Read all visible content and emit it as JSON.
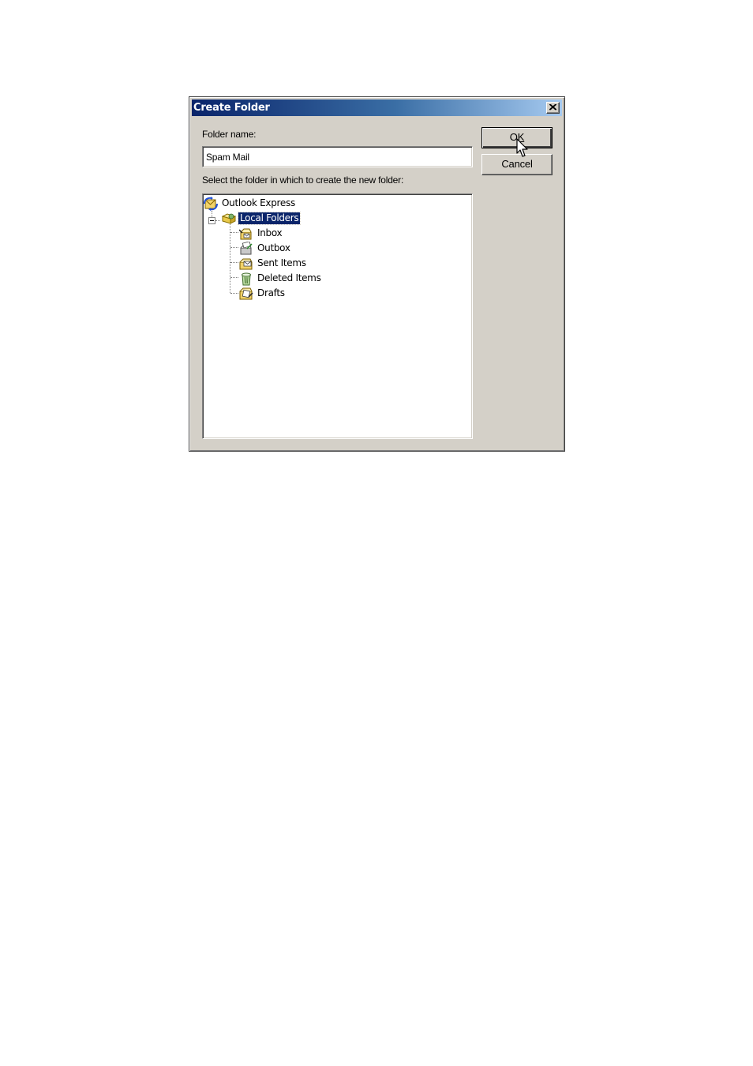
{
  "dialog": {
    "title": "Create Folder",
    "close_icon": "close-x-icon",
    "folder_name_label": "Folder name:",
    "folder_name_value": "Spam Mail",
    "select_label": "Select the folder in which to create the new folder:",
    "ok_prefix": "O",
    "ok_underlined": "K",
    "cancel_label": "Cancel"
  },
  "tree": {
    "root": {
      "label": "Outlook Express",
      "icon": "outlook-express-icon"
    },
    "local": {
      "label": "Local Folders",
      "icon": "local-folders-icon",
      "expanded": true,
      "selected": true
    },
    "children": [
      {
        "label": "Inbox",
        "icon": "inbox-icon"
      },
      {
        "label": "Outbox",
        "icon": "outbox-icon"
      },
      {
        "label": "Sent Items",
        "icon": "sent-items-icon"
      },
      {
        "label": "Deleted Items",
        "icon": "deleted-items-icon"
      },
      {
        "label": "Drafts",
        "icon": "drafts-icon"
      }
    ]
  },
  "colors": {
    "title_gradient_start": "#0a246a",
    "title_gradient_end": "#a6caf0",
    "dialog_face": "#d4d0c8",
    "selection": "#0a246a"
  }
}
